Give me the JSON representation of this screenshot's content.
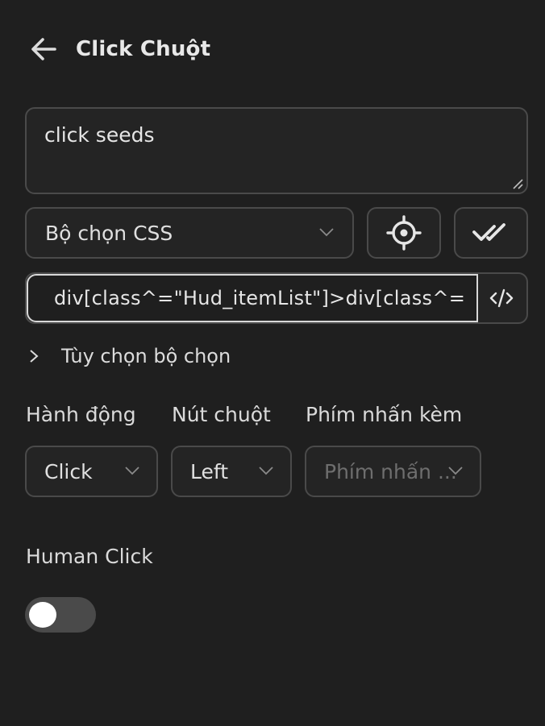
{
  "header": {
    "title": "Click Chuột",
    "back_icon": "arrow-left-icon"
  },
  "description": {
    "value": "click seeds"
  },
  "selector_type": {
    "value": "Bộ chọn CSS"
  },
  "selector": {
    "value": "div[class^=\"Hud_itemList\"]>div[class^="
  },
  "selector_options": {
    "label": "Tùy chọn bộ chọn"
  },
  "action": {
    "label": "Hành động",
    "value": "Click"
  },
  "mouse_button": {
    "label": "Nút chuột",
    "value": "Left"
  },
  "modifier_key": {
    "label": "Phím nhấn kèm",
    "placeholder": "Phím nhấn ..."
  },
  "human_click": {
    "label": "Human Click",
    "enabled": false
  },
  "colors": {
    "background": "#1f1f1f",
    "border": "#4a4a4a",
    "text": "#e6e6e6",
    "placeholder": "#6e6e6e",
    "toggle_off": "#4a4a4a"
  }
}
